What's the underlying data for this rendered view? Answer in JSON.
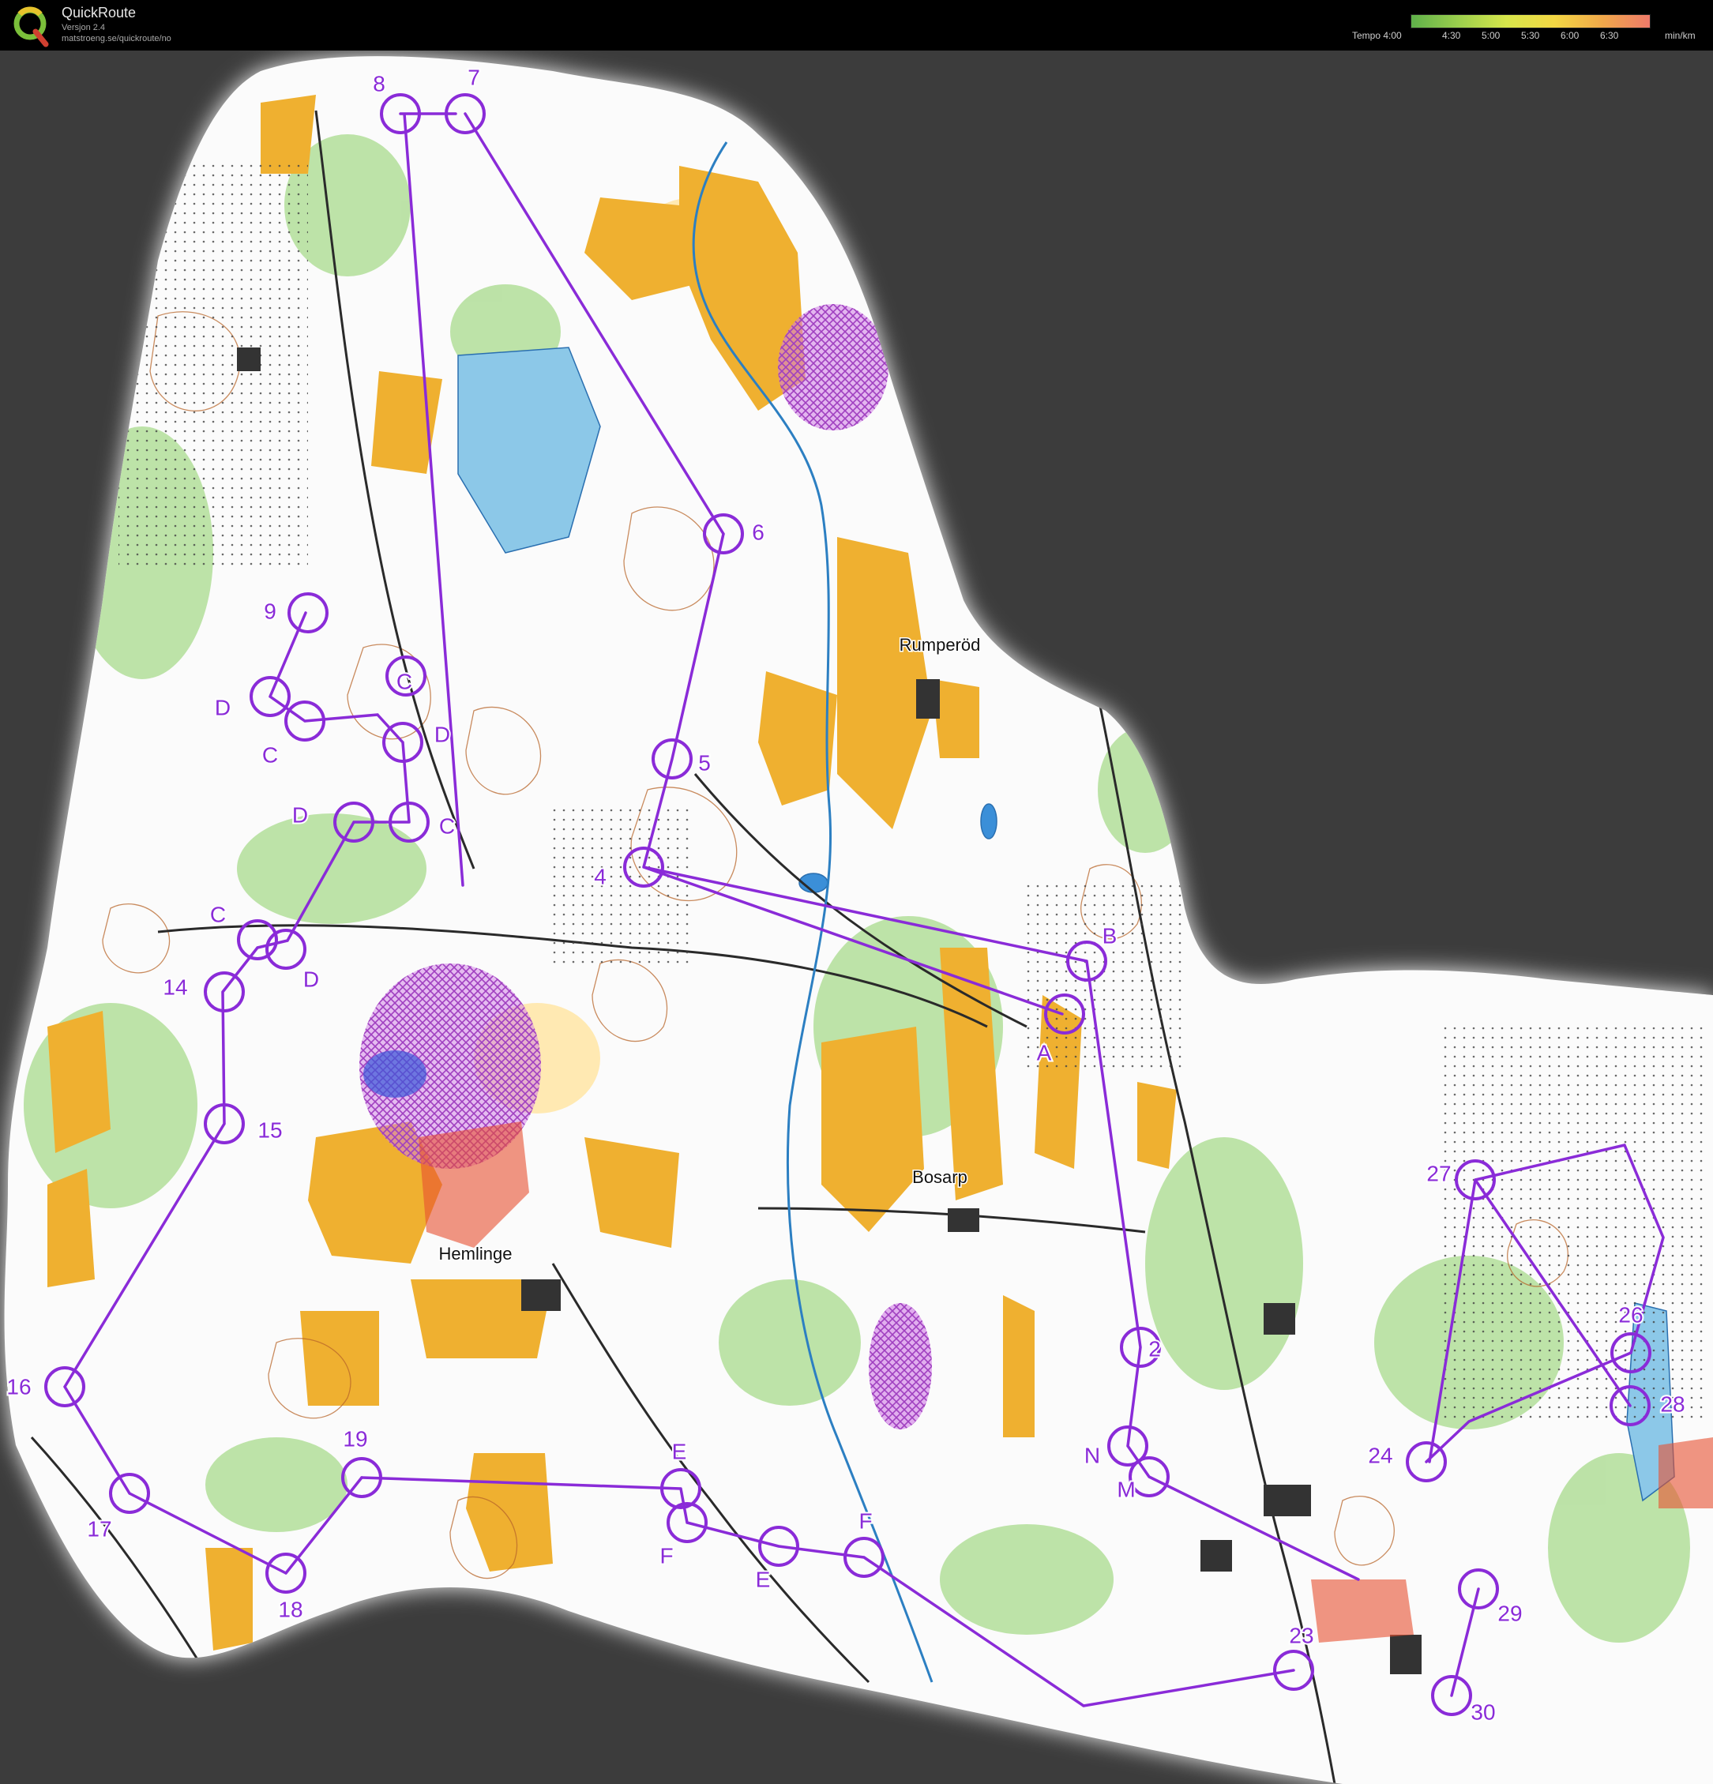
{
  "app": {
    "name": "QuickRoute",
    "version": "Versjon 2.4",
    "url": "matstroeng.se/quickroute/no"
  },
  "legend": {
    "title": "Tempo 4:00",
    "ticks": [
      "4:30",
      "5:00",
      "5:30",
      "6:00",
      "6:30"
    ],
    "unit": "min/km",
    "colors": [
      "#5fb04a",
      "#9ccf4d",
      "#d7e64b",
      "#f3d744",
      "#f0a84a",
      "#ee7a6a"
    ]
  },
  "places": [
    {
      "name": "Rumperöd",
      "id": "rumperod"
    },
    {
      "name": "Bosarp",
      "id": "bosarp"
    },
    {
      "name": "Hemlinge",
      "id": "hemlinge"
    }
  ],
  "controls": [
    {
      "label": "2"
    },
    {
      "label": "4"
    },
    {
      "label": "5"
    },
    {
      "label": "6"
    },
    {
      "label": "7"
    },
    {
      "label": "8"
    },
    {
      "label": "9"
    },
    {
      "label": "14"
    },
    {
      "label": "15"
    },
    {
      "label": "16"
    },
    {
      "label": "17"
    },
    {
      "label": "18"
    },
    {
      "label": "19"
    },
    {
      "label": "23"
    },
    {
      "label": "24"
    },
    {
      "label": "26"
    },
    {
      "label": "27"
    },
    {
      "label": "28"
    },
    {
      "label": "29"
    },
    {
      "label": "30"
    },
    {
      "label": "A"
    },
    {
      "label": "B"
    },
    {
      "label": "C"
    },
    {
      "label": "C"
    },
    {
      "label": "C"
    },
    {
      "label": "C"
    },
    {
      "label": "D"
    },
    {
      "label": "D"
    },
    {
      "label": "D"
    },
    {
      "label": "D"
    },
    {
      "label": "E"
    },
    {
      "label": "E"
    },
    {
      "label": "F"
    },
    {
      "label": "F"
    },
    {
      "label": "M"
    },
    {
      "label": "N"
    }
  ],
  "colors": {
    "course": "#8a2bd8",
    "forest": "#ffffff",
    "green": "#8fd07a",
    "open": "#f0b030",
    "water": "#8cc8e8",
    "contour": "#b8652a"
  }
}
